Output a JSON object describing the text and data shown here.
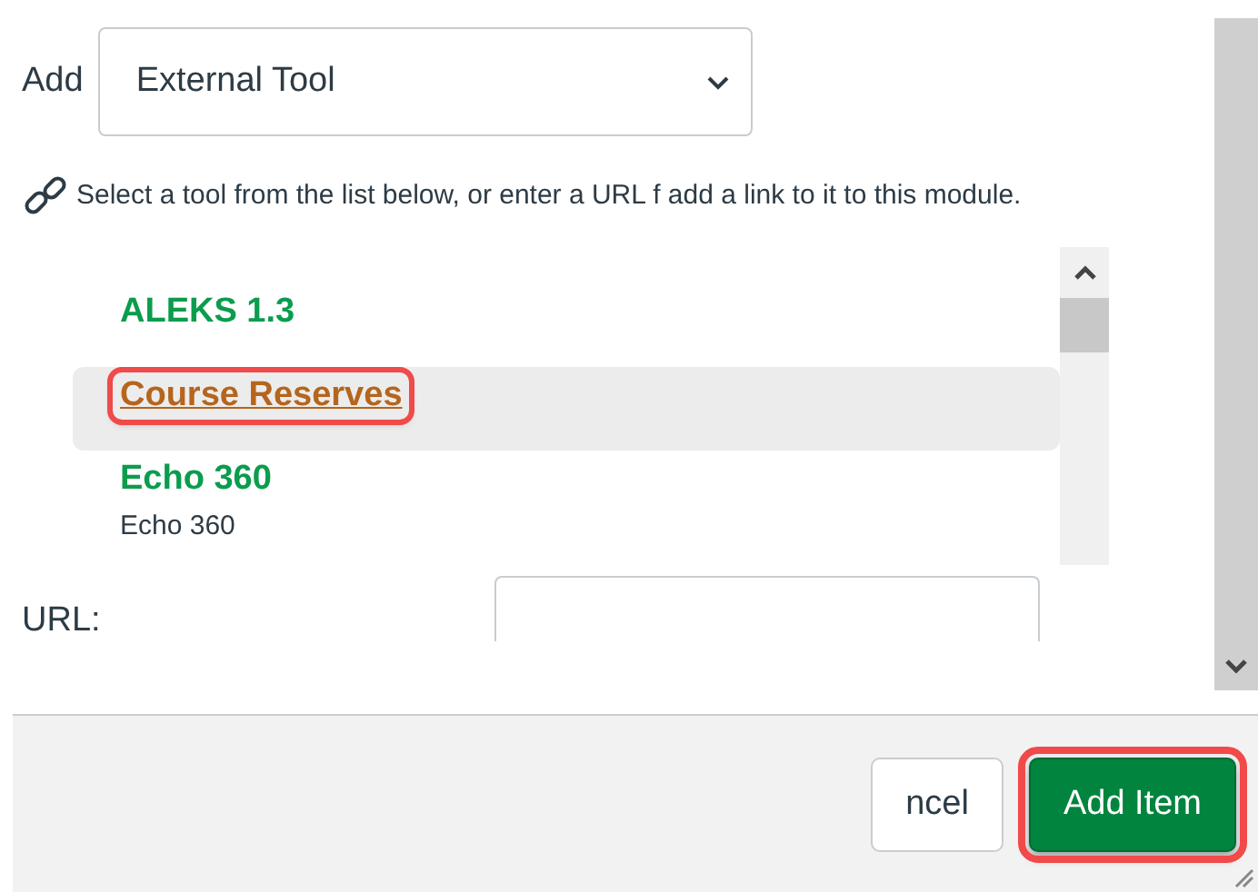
{
  "add_label": "Add",
  "type_select": {
    "value": "External Tool"
  },
  "instructions": "Select a tool from the list below, or enter a URL f  add a link to it to this module.",
  "tools": [
    {
      "name": "ALEKS 1.3",
      "selected": false,
      "highlighted": false
    },
    {
      "name": "Course Reserves",
      "selected": true,
      "highlighted": true
    },
    {
      "name": "Echo 360",
      "description": "Echo 360",
      "selected": false,
      "highlighted": false
    }
  ],
  "url_label": "URL:",
  "buttons": [
    {
      "label": "ncel",
      "kind": "secondary",
      "highlighted": false
    },
    {
      "label": "Add Item",
      "kind": "primary",
      "highlighted": true
    }
  ]
}
